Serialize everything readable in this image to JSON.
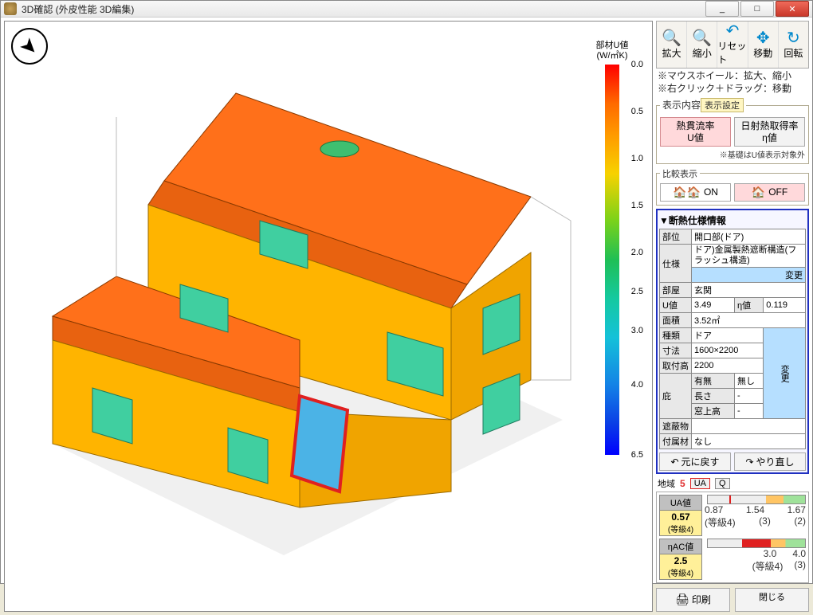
{
  "title": "3D確認 (外皮性能 3D編集)",
  "win_buttons": {
    "min": "_",
    "max": "□",
    "close": "✕"
  },
  "colorbar": {
    "title1": "部材U値",
    "title2": "(W/㎡K)",
    "ticks": [
      "0.0",
      "0.5",
      "1.0",
      "1.5",
      "2.0",
      "2.5",
      "3.0",
      "4.0",
      "6.5"
    ]
  },
  "tools": {
    "zoom_in": "拡大",
    "zoom_out": "縮小",
    "reset": "リセット",
    "move": "移動",
    "rotate": "回転"
  },
  "hints": {
    "l1": "※マウスホイール：拡大、縮小",
    "l2": "※右クリック＋ドラッグ：移動"
  },
  "display": {
    "legend_label": "表示内容",
    "settings_btn": "表示設定",
    "u_btn_l1": "熱貫流率",
    "u_btn_l2": "U値",
    "eta_btn_l1": "日射熱取得率",
    "eta_btn_l2": "η値",
    "foot": "※基礎はU値表示対象外"
  },
  "compare": {
    "legend_label": "比較表示",
    "on": "ON",
    "off": "OFF"
  },
  "panel": {
    "title": "▼断熱仕様情報",
    "labels": {
      "bui": "部位",
      "shiyo": "仕様",
      "heya": "部屋",
      "u": "U値",
      "eta": "η値",
      "menseki": "面積",
      "shurui": "種類",
      "sunpo": "寸法",
      "toritsuke": "取付高",
      "hisashi": "庇",
      "umu": "有無",
      "nagasa": "長さ",
      "madokami": "窓上高",
      "shahei": "遮蔽物",
      "fuzoku": "付属材"
    },
    "values": {
      "bui": "開口部(ドア)",
      "shiyo": "ドア)金属製熱遮断構造(フラッシュ構造)",
      "heya": "玄関",
      "u": "3.49",
      "eta": "0.119",
      "menseki": "3.52㎡",
      "shurui": "ドア",
      "sunpo": "1600×2200",
      "toritsuke": "2200",
      "umu": "無し",
      "nagasa": "-",
      "madokami": "-",
      "shahei": "",
      "fuzoku": "なし"
    },
    "change": "変更",
    "undo": "元に戻す",
    "redo": "やり直し"
  },
  "region": {
    "label": "地域",
    "value": "5",
    "tab_ua": "UA",
    "tab_q": "Q"
  },
  "metrics": {
    "ua_name": "UA値",
    "ua_val": "0.57",
    "ua_grade": "(等級4)",
    "ua_ticks": [
      "0.87",
      "1.54",
      "1.67"
    ],
    "ua_tick_sub": [
      "(等級4)",
      "(3)",
      "(2)"
    ],
    "ac_name": "ηAC値",
    "ac_val": "2.5",
    "ac_grade": "(等級4)",
    "ac_ticks": [
      "3.0",
      "4.0"
    ],
    "ac_tick_sub": [
      "(等級4)",
      "(3)"
    ]
  },
  "actions": {
    "print": "印刷",
    "close": "閉じる"
  },
  "chart_data": {
    "type": "heatmap",
    "title": "部材U値 (W/㎡K)",
    "colorbar": {
      "label": "部材U値 (W/㎡K)",
      "min": 0.0,
      "max": 6.5,
      "ticks": [
        0.0,
        0.5,
        1.0,
        1.5,
        2.0,
        2.5,
        3.0,
        4.0,
        6.5
      ],
      "gradient": [
        "#ff0000",
        "#ff6a00",
        "#ff9a00",
        "#f7d200",
        "#7ad21a",
        "#1fbf55",
        "#15c9a0",
        "#14c1d9",
        "#1483e6",
        "#0a3ee6",
        "#0000ff"
      ]
    },
    "surfaces": [
      {
        "name": "屋根",
        "u": 0.3,
        "color": "#ff6b1a"
      },
      {
        "name": "外壁",
        "u": 0.5,
        "color": "#ffb400"
      },
      {
        "name": "一般窓",
        "u": 2.3,
        "color": "#2fc7a0"
      },
      {
        "name": "玄関ドア(選択)",
        "u": 3.49,
        "color": "#36a8e0",
        "selected": true
      }
    ],
    "note": "※基礎はU値表示対象外"
  }
}
